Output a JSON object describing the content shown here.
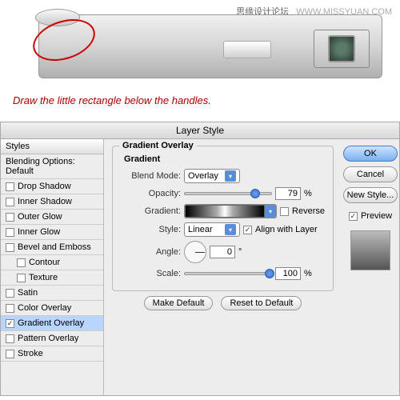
{
  "watermark": {
    "cn": "思缘设计论坛",
    "url": "WWW.MISSYUAN.COM"
  },
  "instruction": "Draw the little rectangle below the handles.",
  "dialog": {
    "title": "Layer Style",
    "stylesHeader": "Styles",
    "blending": "Blending Options: Default",
    "items": [
      {
        "label": "Drop Shadow",
        "checked": false,
        "indent": false,
        "selected": false
      },
      {
        "label": "Inner Shadow",
        "checked": false,
        "indent": false,
        "selected": false
      },
      {
        "label": "Outer Glow",
        "checked": false,
        "indent": false,
        "selected": false
      },
      {
        "label": "Inner Glow",
        "checked": false,
        "indent": false,
        "selected": false
      },
      {
        "label": "Bevel and Emboss",
        "checked": false,
        "indent": false,
        "selected": false
      },
      {
        "label": "Contour",
        "checked": false,
        "indent": true,
        "selected": false
      },
      {
        "label": "Texture",
        "checked": false,
        "indent": true,
        "selected": false
      },
      {
        "label": "Satin",
        "checked": false,
        "indent": false,
        "selected": false
      },
      {
        "label": "Color Overlay",
        "checked": false,
        "indent": false,
        "selected": false
      },
      {
        "label": "Gradient Overlay",
        "checked": true,
        "indent": false,
        "selected": true
      },
      {
        "label": "Pattern Overlay",
        "checked": false,
        "indent": false,
        "selected": false
      },
      {
        "label": "Stroke",
        "checked": false,
        "indent": false,
        "selected": false
      }
    ]
  },
  "panel": {
    "groupTitle": "Gradient Overlay",
    "subTitle": "Gradient",
    "blendModeLabel": "Blend Mode:",
    "blendModeValue": "Overlay",
    "opacityLabel": "Opacity:",
    "opacityValue": "79",
    "percent": "%",
    "gradientLabel": "Gradient:",
    "reverseLabel": "Reverse",
    "reverseChecked": false,
    "styleLabel": "Style:",
    "styleValue": "Linear",
    "alignLabel": "Align with Layer",
    "alignChecked": true,
    "angleLabel": "Angle:",
    "angleValue": "0",
    "degree": "°",
    "scaleLabel": "Scale:",
    "scaleValue": "100",
    "makeDefault": "Make Default",
    "resetDefault": "Reset to Default"
  },
  "buttons": {
    "ok": "OK",
    "cancel": "Cancel",
    "newStyle": "New Style...",
    "preview": "Preview"
  }
}
